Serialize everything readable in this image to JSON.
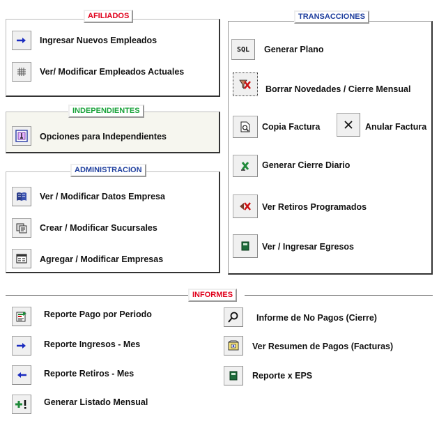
{
  "afiliados": {
    "title": "AFILIADOS",
    "title_color": "#e0001b",
    "items": [
      {
        "label": "Ingresar Nuevos Empleados",
        "icon": "arrow-right-icon"
      },
      {
        "label": "Ver/ Modificar Empleados Actuales",
        "icon": "grid-icon"
      }
    ]
  },
  "independientes": {
    "title": "INDEPENDIENTES",
    "title_color": "#1aa33b",
    "items": [
      {
        "label": "Opciones para Independientes",
        "icon": "independent-icon"
      }
    ]
  },
  "administracion": {
    "title": "ADMINISTRACION",
    "title_color": "#1f3f9e",
    "items": [
      {
        "label": "Ver / Modificar Datos Empresa",
        "icon": "book-icon"
      },
      {
        "label": "Crear / Modificar Sucursales",
        "icon": "branch-icon"
      },
      {
        "label": "Agregar / Modificar Empresas",
        "icon": "form-icon"
      }
    ]
  },
  "transacciones": {
    "title": "TRANSACCIONES",
    "title_color": "#1f3f9e",
    "items": [
      {
        "label": "Generar Plano",
        "icon": "sql-icon",
        "icon_text": "SQL"
      },
      {
        "label": "Borrar Novedades / Cierre Mensual",
        "icon": "delete-filter-icon"
      },
      {
        "label": "Copia Factura",
        "icon": "print-preview-icon"
      },
      {
        "label": "Anular Factura",
        "icon": "cancel-x-icon"
      },
      {
        "label": "Generar Cierre Diario",
        "icon": "excel-icon"
      },
      {
        "label": "Ver Retiros Programados",
        "icon": "retiros-icon"
      },
      {
        "label": "Ver / Ingresar Egresos",
        "icon": "green-book-icon"
      }
    ]
  },
  "informes": {
    "title": "INFORMES",
    "title_color": "#e0001b",
    "left": [
      {
        "label": "Reporte Pago por Periodo",
        "icon": "report-icon"
      },
      {
        "label": "Reporte Ingresos - Mes",
        "icon": "arrow-right-icon"
      },
      {
        "label": "Reporte Retiros - Mes",
        "icon": "arrow-left-icon"
      },
      {
        "label": "Generar Listado Mensual",
        "icon": "plus-alert-icon"
      }
    ],
    "right": [
      {
        "label": "Informe de No Pagos (Cierre)",
        "icon": "magnifier-icon"
      },
      {
        "label": "Ver Resumen de Pagos (Facturas)",
        "icon": "summary-icon"
      },
      {
        "label": "Reporte x EPS",
        "icon": "green-book-icon"
      }
    ]
  }
}
